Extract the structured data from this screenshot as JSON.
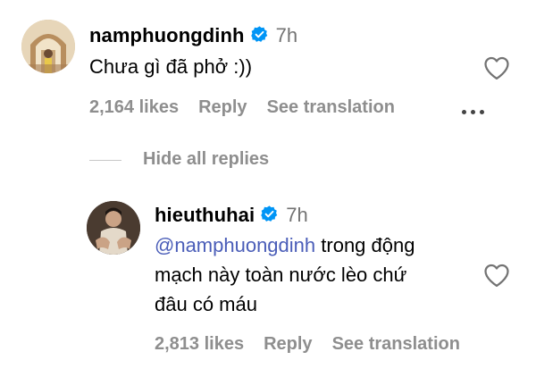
{
  "comment": {
    "username": "namphuongdinh",
    "time": "7h",
    "text": "Chưa gì đã phở :))",
    "likes": "2,164 likes",
    "reply_label": "Reply",
    "translation_label": "See translation"
  },
  "replies_toggle": "Hide all replies",
  "reply": {
    "username": "hieuthuhai",
    "time": "7h",
    "mention": "@namphuongdinh",
    "text_line1": "trong động",
    "text_line2": "mạch này toàn nước lèo chứ",
    "text_line3": "đâu có máu",
    "likes": "2,813 likes",
    "reply_label": "Reply",
    "translation_label": "See translation"
  },
  "icons": {
    "verified": "verified-badge-icon",
    "like": "heart-icon",
    "more": "more-options-icon"
  },
  "colors": {
    "verified": "#0095f6",
    "mention": "#4a5db8",
    "meta": "#8e8e8e"
  }
}
